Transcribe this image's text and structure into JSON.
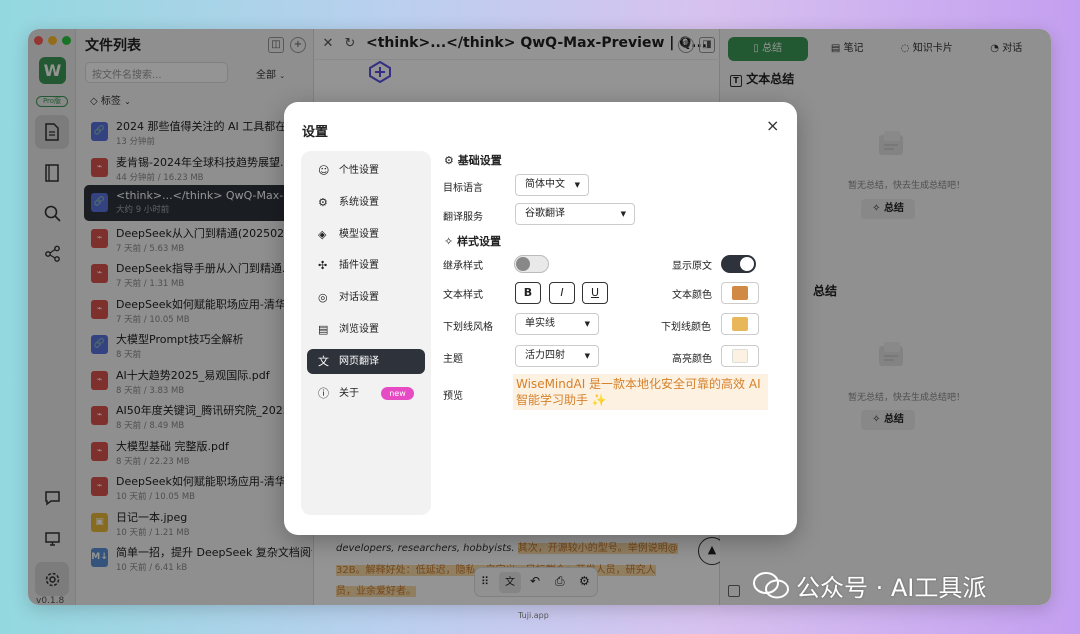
{
  "app": {
    "version": "v0.1.8",
    "logo_letter": "W",
    "badge": "Pro版"
  },
  "sidebar": {
    "title": "文件列表",
    "search_placeholder": "按文件名搜索...",
    "filter": "全部",
    "tag_label": "标签"
  },
  "files": [
    {
      "name": "2024 那些值得关注的 AI 工具都在这儿",
      "meta": "13 分钟前",
      "type": "link"
    },
    {
      "name": "麦肯锡-2024年全球科技趋势展望.pdf",
      "meta": "44 分钟前 / 16.23 MB",
      "type": "pdf"
    },
    {
      "name": "<think>...</think> QwQ-Max-Previe...",
      "meta": "大约 9 小时前",
      "type": "link",
      "selected": true
    },
    {
      "name": "DeepSeek从入门到精通(20250204).pdf",
      "meta": "7 天前 / 5.63 MB",
      "type": "pdf"
    },
    {
      "name": "DeepSeek指导手册从入门到精通.pdf",
      "meta": "7 天前 / 1.31 MB",
      "type": "pdf"
    },
    {
      "name": "DeepSeek如何赋能职场应用-清华大学",
      "meta": "7 天前 / 10.05 MB",
      "type": "pdf"
    },
    {
      "name": "大模型Prompt技巧全解析",
      "meta": "8 天前",
      "type": "link"
    },
    {
      "name": "AI十大趋势2025_易观国际.pdf",
      "meta": "8 天前 / 3.83 MB",
      "type": "pdf"
    },
    {
      "name": "AI50年度关键词_腾讯研究院_2025.01",
      "meta": "8 天前 / 8.49 MB",
      "type": "pdf"
    },
    {
      "name": "大模型基础 完整版.pdf",
      "meta": "8 天前 / 22.23 MB",
      "type": "pdf"
    },
    {
      "name": "DeepSeek如何赋能职场应用-清华大学",
      "meta": "10 天前 / 10.05 MB",
      "type": "pdf"
    },
    {
      "name": "日记一本.jpeg",
      "meta": "10 天前 / 1.21 MB",
      "type": "image"
    },
    {
      "name": "简单一招，提升 DeepSeek 复杂文档阅读",
      "meta": "10 天前 / 6.41 kB",
      "type": "md"
    }
  ],
  "document": {
    "title": "<think>...</think> QwQ-Max-Preview | Q...",
    "line1_plain": "developers, researchers, hobbyists. ",
    "line1_hl": "其次，开源较小的型号。举例说明@",
    "line2_hl": "32B。解释好处：低延迟，隐私，自定义，目标群众：开发人员，研究人",
    "line3_hl": "员，业余爱好者。"
  },
  "right_panel": {
    "tabs": [
      "总结",
      "笔记",
      "知识卡片",
      "对话"
    ],
    "section1": "文本总结",
    "empty_text": "暂无总结，快去生成总结吧！",
    "summary_button": "总结",
    "section2": "总结"
  },
  "settings": {
    "title": "设置",
    "close": "×",
    "nav": [
      "个性设置",
      "系统设置",
      "模型设置",
      "插件设置",
      "对话设置",
      "浏览设置",
      "网页翻译",
      "关于"
    ],
    "active_nav": "网页翻译",
    "new_badge": "new",
    "basic_header": "基础设置",
    "target_lang_label": "目标语言",
    "target_lang_value": "简体中文",
    "translate_service_label": "翻译服务",
    "translate_service_value": "谷歌翻译",
    "style_header": "样式设置",
    "inherit_style_label": "继承样式",
    "inherit_style_on": false,
    "show_original_label": "显示原文",
    "show_original_on": true,
    "text_style_label": "文本样式",
    "text_style_buttons": [
      "B",
      "I",
      "U"
    ],
    "text_color_label": "文本颜色",
    "text_color": "#d08a45",
    "underline_style_label": "下划线风格",
    "underline_style_value": "单实线",
    "underline_color_label": "下划线颜色",
    "underline_color": "#e8b75a",
    "theme_label": "主题",
    "theme_value": "活力四射",
    "highlight_color_label": "高亮颜色",
    "highlight_color": "#fdf1e2",
    "preview_label": "预览",
    "preview_text": "WiseMindAI 是一款本地化安全可靠的高效 AI 智能学习助手 ✨"
  },
  "watermark": {
    "text": "公众号 · AI工具派",
    "capture_label": "Tuji.app"
  }
}
